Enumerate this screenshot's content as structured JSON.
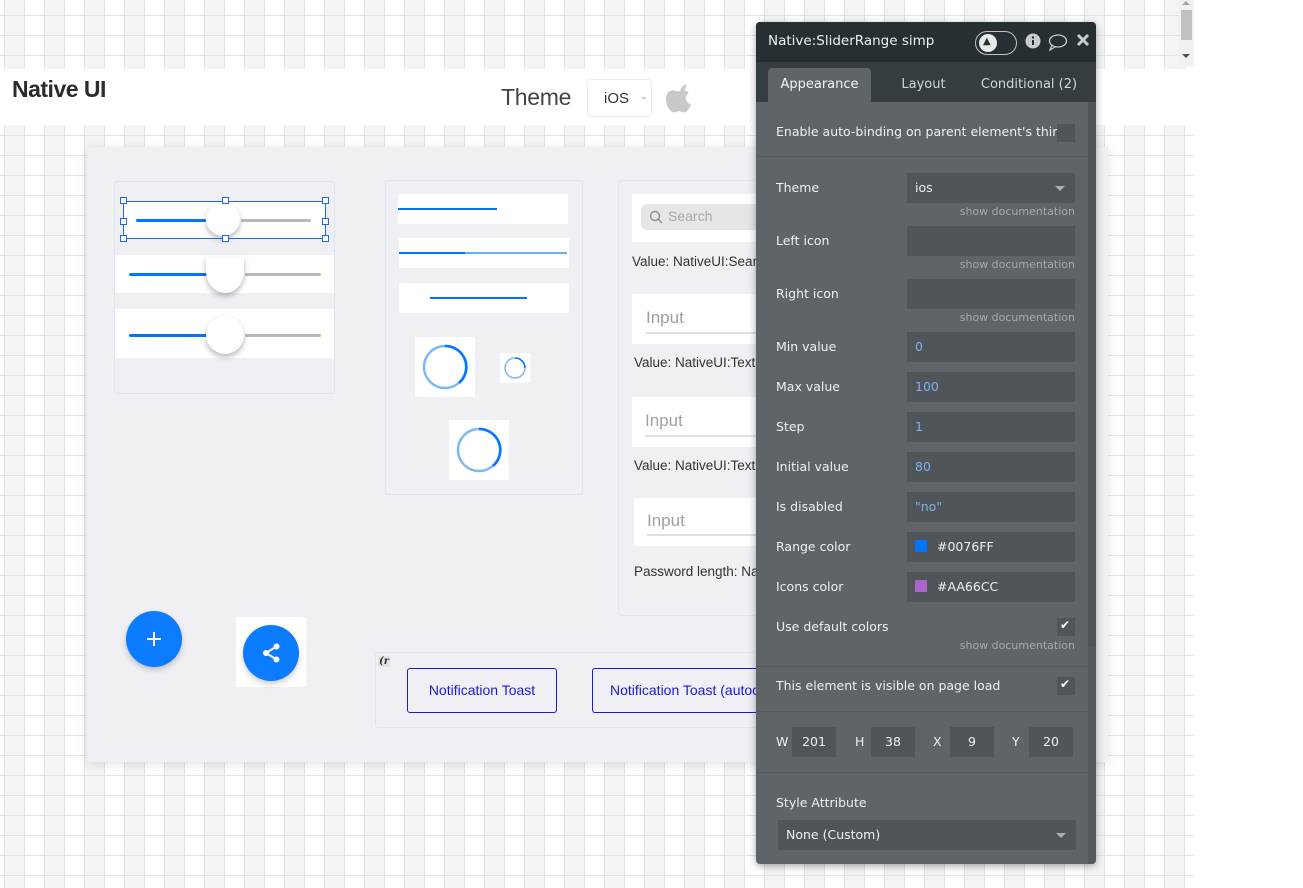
{
  "page": {
    "title": "Native UI",
    "theme_label": "Theme",
    "theme_select": {
      "value": "iOS"
    },
    "theme_icon": "apple-icon"
  },
  "sliders": {
    "rows": [
      {
        "value_fraction": 0.45,
        "selected": true
      },
      {
        "value_fraction": 0.45,
        "selected": false
      },
      {
        "value_fraction": 0.45,
        "selected": false
      }
    ]
  },
  "progress": {
    "linear": [
      {
        "fraction": 0.58
      },
      {
        "fraction": 0.39,
        "buffer": 1.0
      },
      {
        "fraction": 1.0
      }
    ],
    "spinners": [
      "spinner-large",
      "spinner-small",
      "spinner-medium"
    ]
  },
  "inputs": {
    "search": {
      "placeholder": "Search",
      "value_text": "Value: NativeUI:Search"
    },
    "text1": {
      "placeholder": "Input",
      "value_text": "Value: NativeUI:Text"
    },
    "text2": {
      "placeholder": "Input",
      "value_text": "Value: NativeUI:Text"
    },
    "password": {
      "placeholder": "Input",
      "value_text": "Password length: Na"
    }
  },
  "fabs": {
    "add": {
      "icon": "plus-icon",
      "glyph": "+"
    },
    "share": {
      "icon": "share-icon"
    }
  },
  "toasts": {
    "tag": "(r",
    "buttons": [
      {
        "label": "Notification Toast"
      },
      {
        "label": "Notification Toast (autoclose)"
      }
    ]
  },
  "panel": {
    "title": "Native:SliderRange simp",
    "tabs": [
      {
        "label": "Appearance",
        "active": true
      },
      {
        "label": "Layout",
        "active": false
      },
      {
        "label": "Conditional (2)",
        "active": false
      }
    ],
    "autobinding_label": "Enable auto-binding on parent element's thing",
    "autobinding_checked": false,
    "show_doc": "show documentation",
    "fields": {
      "theme": {
        "label": "Theme",
        "value": "ios"
      },
      "left_icon": {
        "label": "Left icon",
        "value": ""
      },
      "right_icon": {
        "label": "Right icon",
        "value": ""
      },
      "min_value": {
        "label": "Min value",
        "value": "0"
      },
      "max_value": {
        "label": "Max value",
        "value": "100"
      },
      "step": {
        "label": "Step",
        "value": "1"
      },
      "initial_value": {
        "label": "Initial value",
        "value": "80"
      },
      "is_disabled": {
        "label": "Is disabled",
        "value": "\"no\""
      },
      "range_color": {
        "label": "Range color",
        "value": "#0076FF",
        "swatch": "#0076FF"
      },
      "icons_color": {
        "label": "Icons color",
        "value": "#AA66CC",
        "swatch": "#AA66CC"
      }
    },
    "use_default_colors": {
      "label": "Use default colors",
      "checked": true
    },
    "visible_on_load": {
      "label": "This element is visible on page load",
      "checked": true
    },
    "dimensions": {
      "w": {
        "label": "W",
        "value": "201"
      },
      "h": {
        "label": "H",
        "value": "38"
      },
      "x": {
        "label": "X",
        "value": "9"
      },
      "y": {
        "label": "Y",
        "value": "20"
      }
    },
    "style_attribute": {
      "label": "Style Attribute",
      "value": "None (Custom)"
    }
  }
}
